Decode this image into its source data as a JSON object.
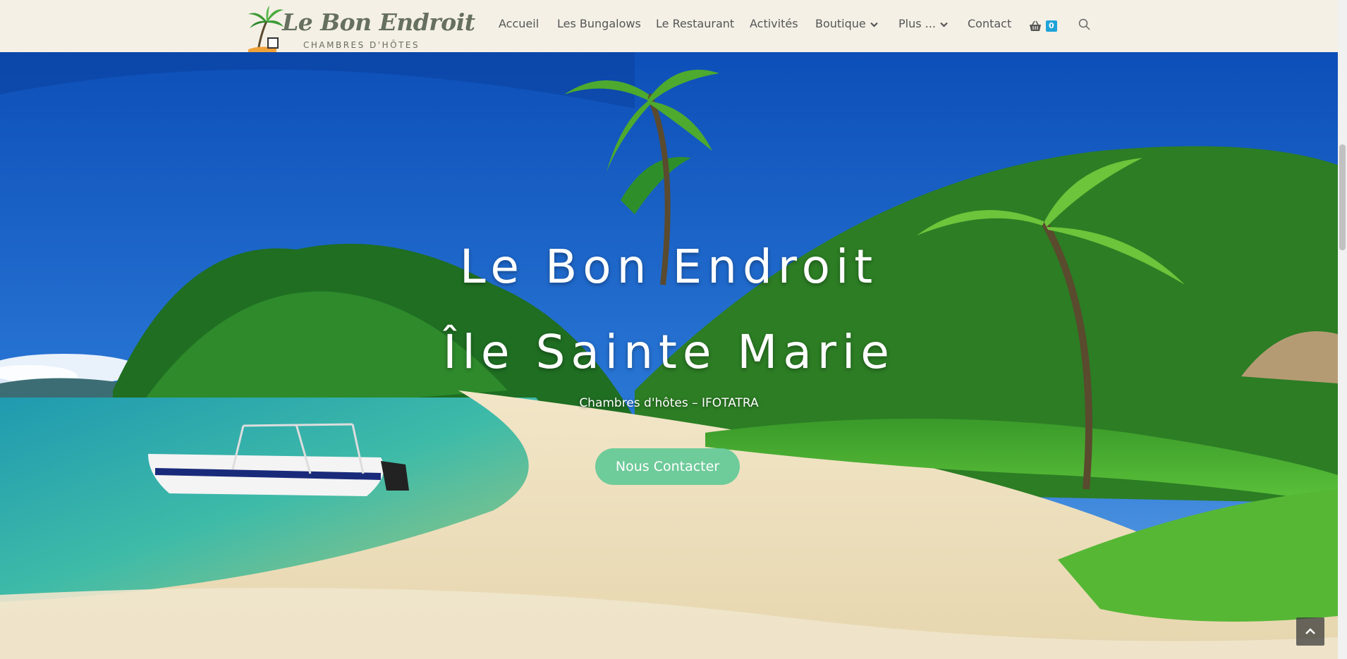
{
  "brand": {
    "name": "Le Bon Endroit",
    "tagline": "CHAMBRES D'HÔTES"
  },
  "nav": {
    "items": [
      "Accueil",
      "Les Bungalows",
      "Le Restaurant",
      "Activités",
      "Boutique",
      "Plus ...",
      "Contact"
    ],
    "cart_count": "0"
  },
  "hero": {
    "title": "Le Bon Endroit",
    "subtitle_large": "Île Sainte Marie",
    "subtitle_small": "Chambres d'hôtes – IFOTATRA",
    "cta_label": "Nous Contacter"
  },
  "colors": {
    "header_bg": "#f4f0e6",
    "nav_text": "#555555",
    "cart_badge": "#1fa3d8",
    "cta_bg": "#5fc996",
    "logo_text": "#66705f"
  },
  "icons": {
    "cart": "shopping-basket-icon",
    "search": "search-icon",
    "dropdown": "chevron-down-icon",
    "back_to_top": "chevron-up-icon"
  }
}
